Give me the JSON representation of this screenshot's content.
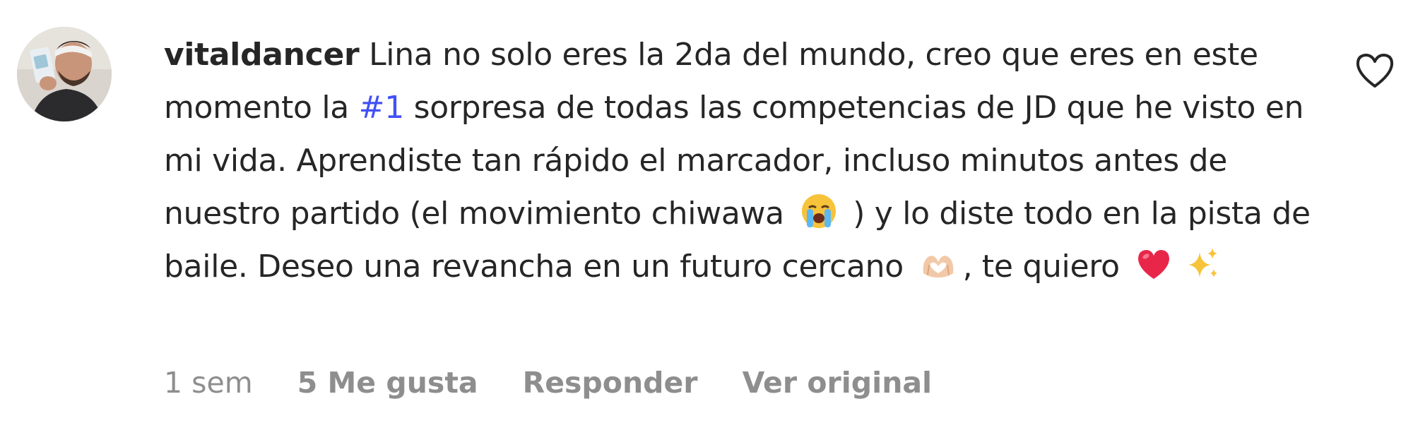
{
  "comment": {
    "username": "vitaldancer",
    "text_part1": " Lina no solo eres la 2da del mundo, creo que eres en este momento la ",
    "hashtag": "#1",
    "text_part2": " sorpresa de todas las competencias de JD que he visto en mi vida. Aprendiste tan rápido el marcador, incluso minutos antes de nuestro partido (el movimiento chiwawa ",
    "text_part3": " ) y lo diste todo en la pista de baile. Deseo una revancha en un futuro cercano ",
    "text_part4": ", te quiero ",
    "emojis": [
      "loudly-crying-face-emoji",
      "heart-hands-emoji",
      "red-heart-emoji",
      "sparkles-emoji"
    ],
    "meta": {
      "time": "1 sem",
      "likes": "5 Me gusta",
      "reply": "Responder",
      "see_original": "Ver original"
    }
  },
  "colors": {
    "text": "#262626",
    "muted": "#8e8e8e",
    "hashtag": "#4150f7",
    "heart_emoji": "#e8264a"
  }
}
